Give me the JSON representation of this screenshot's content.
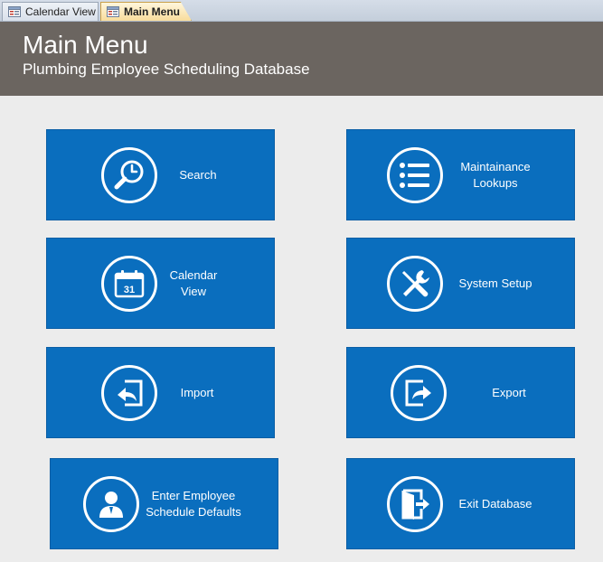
{
  "tabs": [
    {
      "label": "Calendar View",
      "icon": "form-icon",
      "active": false
    },
    {
      "label": "Main Menu",
      "icon": "form-icon",
      "active": true
    }
  ],
  "header": {
    "title": "Main Menu",
    "subtitle": "Plumbing Employee Scheduling Database"
  },
  "buttons": {
    "search": {
      "label": "Search",
      "icon": "magnifier-clock-icon"
    },
    "maintenance": {
      "label": "Maintainance\nLookups",
      "icon": "list-icon"
    },
    "calendar": {
      "label": "Calendar\nView",
      "icon": "calendar-icon"
    },
    "system_setup": {
      "label": "System Setup",
      "icon": "tools-icon"
    },
    "import": {
      "label": "Import",
      "icon": "import-icon"
    },
    "export": {
      "label": "Export",
      "icon": "export-icon"
    },
    "employee_defaults": {
      "label": "Enter Employee\nSchedule Defaults",
      "icon": "user-icon"
    },
    "exit": {
      "label": "Exit Database",
      "icon": "exit-door-icon"
    }
  },
  "colors": {
    "button_blue": "#0a6ebe",
    "header_bg": "#6b6560",
    "page_bg": "#ececec",
    "active_tab": "#f8dc9b"
  }
}
